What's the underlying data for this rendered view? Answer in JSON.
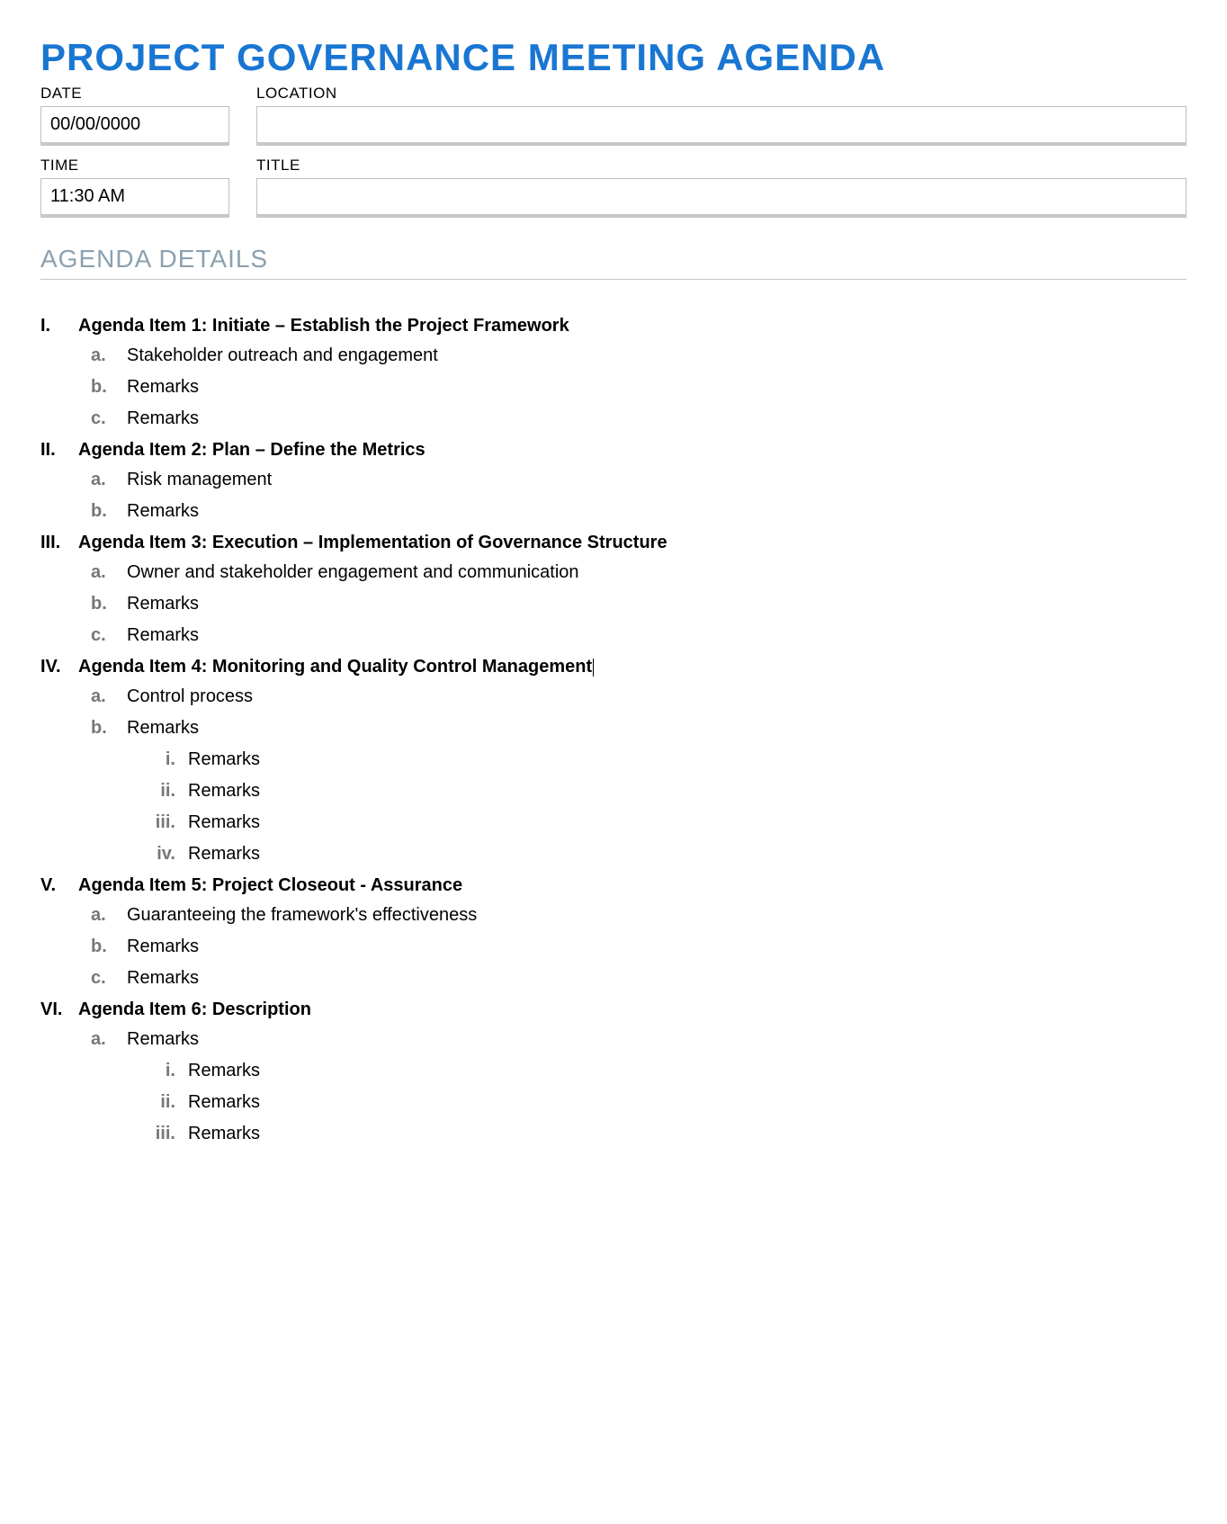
{
  "title": "PROJECT GOVERNANCE MEETING AGENDA",
  "meta": {
    "date_label": "DATE",
    "date_value": "00/00/0000",
    "location_label": "LOCATION",
    "location_value": "",
    "time_label": "TIME",
    "time_value": "11:30 AM",
    "title_label": "TITLE",
    "title_value": ""
  },
  "section_header": "AGENDA DETAILS",
  "roman": [
    "I.",
    "II.",
    "III.",
    "IV.",
    "V.",
    "VI."
  ],
  "alpha": [
    "a.",
    "b.",
    "c."
  ],
  "subroman": [
    "i.",
    "ii.",
    "iii.",
    "iv."
  ],
  "agenda": [
    {
      "title": "Agenda Item 1: Initiate – Establish the Project Framework",
      "subs": [
        {
          "text": "Stakeholder outreach and engagement"
        },
        {
          "text": "Remarks"
        },
        {
          "text": "Remarks"
        }
      ]
    },
    {
      "title": "Agenda Item 2: Plan – Define the Metrics",
      "subs": [
        {
          "text": "Risk management"
        },
        {
          "text": "Remarks"
        }
      ]
    },
    {
      "title": "Agenda Item 3: Execution – Implementation of Governance Structure",
      "subs": [
        {
          "text": "Owner and stakeholder engagement and communication"
        },
        {
          "text": "Remarks"
        },
        {
          "text": "Remarks"
        }
      ]
    },
    {
      "title": "Agenda Item 4: Monitoring and Quality Control Management",
      "cursor": true,
      "subs": [
        {
          "text": "Control process"
        },
        {
          "text": "Remarks",
          "subsubs": [
            "Remarks",
            "Remarks",
            "Remarks",
            "Remarks"
          ]
        }
      ]
    },
    {
      "title": "Agenda Item 5: Project Closeout - Assurance",
      "subs": [
        {
          "text": "Guaranteeing the framework's effectiveness"
        },
        {
          "text": "Remarks"
        },
        {
          "text": "Remarks"
        }
      ]
    },
    {
      "title": "Agenda Item 6: Description",
      "subs": [
        {
          "text": "Remarks",
          "subsubs": [
            "Remarks",
            "Remarks",
            "Remarks"
          ]
        }
      ]
    }
  ]
}
